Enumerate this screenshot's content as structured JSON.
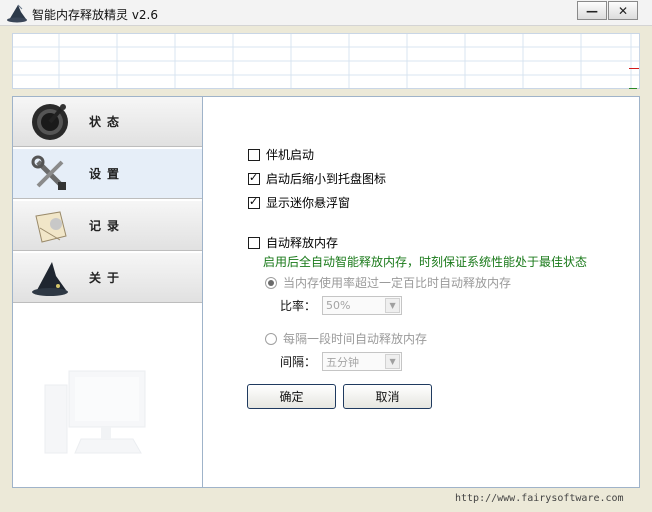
{
  "window": {
    "title": "智能内存释放精灵 v2.6",
    "minimize_glyph": "—",
    "close_glyph": "✕"
  },
  "nav": {
    "items": [
      {
        "label": "状态",
        "icon": "dial-icon"
      },
      {
        "label": "设置",
        "icon": "tools-icon"
      },
      {
        "label": "记录",
        "icon": "clipboard-icon"
      },
      {
        "label": "关于",
        "icon": "wizard-hat-icon"
      }
    ],
    "active_index": 1
  },
  "settings": {
    "startup_label": "伴机启动",
    "startup_checked": false,
    "minimize_tray_label": "启动后缩小到托盘图标",
    "minimize_tray_checked": true,
    "float_window_label": "显示迷你悬浮窗",
    "float_window_checked": true,
    "auto_release_label": "自动释放内存",
    "auto_release_checked": false,
    "auto_release_hint": "启用后全自动智能释放内存，时刻保证系统性能处于最佳状态",
    "mode_percent_label": "当内存使用率超过一定百比时自动释放内存",
    "ratio_label": "比率：",
    "ratio_value": "50%",
    "mode_interval_label": "每隔一段时间自动释放内存",
    "interval_label": "间隔：",
    "interval_value": "五分钟",
    "ok_label": "确定",
    "cancel_label": "取消"
  },
  "footer": {
    "url": "http://www.fairysoftware.com"
  },
  "colors": {
    "hint_green": "#1a7a1a",
    "graph_red": "#d41a1a"
  }
}
